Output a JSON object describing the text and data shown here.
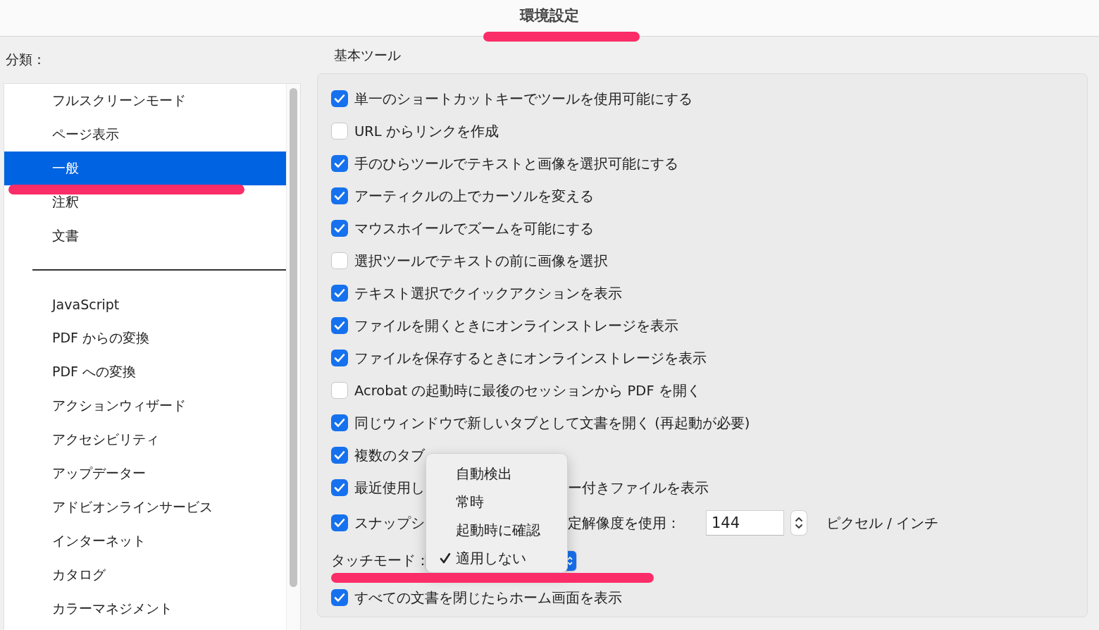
{
  "window": {
    "title": "環境設定",
    "highlighted": true
  },
  "sidebar": {
    "label": "分類：",
    "items": [
      {
        "label": "フルスクリーンモード",
        "selected": false,
        "highlighted": false
      },
      {
        "label": "ページ表示",
        "selected": false,
        "highlighted": false
      },
      {
        "label": "一般",
        "selected": true,
        "highlighted": true
      },
      {
        "label": "注釈",
        "selected": false,
        "highlighted": false
      },
      {
        "label": "文書",
        "selected": false,
        "highlighted": false
      },
      {
        "kind": "divider"
      },
      {
        "label": "JavaScript",
        "selected": false,
        "highlighted": false
      },
      {
        "label": "PDF からの変換",
        "selected": false,
        "highlighted": false
      },
      {
        "label": "PDF への変換",
        "selected": false,
        "highlighted": false
      },
      {
        "label": "アクションウィザード",
        "selected": false,
        "highlighted": false
      },
      {
        "label": "アクセシビリティ",
        "selected": false,
        "highlighted": false
      },
      {
        "label": "アップデーター",
        "selected": false,
        "highlighted": false
      },
      {
        "label": "アドビオンラインサービス",
        "selected": false,
        "highlighted": false
      },
      {
        "label": "インターネット",
        "selected": false,
        "highlighted": false
      },
      {
        "label": "カタログ",
        "selected": false,
        "highlighted": false
      },
      {
        "label": "カラーマネジメント",
        "selected": false,
        "highlighted": false
      }
    ]
  },
  "section": {
    "title": "基本ツール",
    "rows": [
      {
        "kind": "checkbox",
        "label": "単一のショートカットキーでツールを使用可能にする",
        "checked": true
      },
      {
        "kind": "checkbox",
        "label": "URL からリンクを作成",
        "checked": false
      },
      {
        "kind": "checkbox",
        "label": "手のひらツールでテキストと画像を選択可能にする",
        "checked": true
      },
      {
        "kind": "checkbox",
        "label": "アーティクルの上でカーソルを変える",
        "checked": true
      },
      {
        "kind": "checkbox",
        "label": "マウスホイールでズームを可能にする",
        "checked": true
      },
      {
        "kind": "checkbox",
        "label": "選択ツールでテキストの前に画像を選択",
        "checked": false
      },
      {
        "kind": "checkbox",
        "label": "テキスト選択でクイックアクションを表示",
        "checked": true
      },
      {
        "kind": "checkbox",
        "label": "ファイルを開くときにオンラインストレージを表示",
        "checked": true
      },
      {
        "kind": "checkbox",
        "label": "ファイルを保存するときにオンラインストレージを表示",
        "checked": true
      },
      {
        "kind": "checkbox",
        "label": "Acrobat の起動時に最後のセッションから PDF を開く",
        "checked": false
      },
      {
        "kind": "checkbox",
        "label": "同じウィンドウで新しいタブとして文書を開く (再起動が必要)",
        "checked": true
      },
      {
        "kind": "checkbox",
        "label": "複数のタブ",
        "checked": true
      },
      {
        "kind": "split",
        "label": "最近使用し",
        "tail": "ー付きファイルを表示",
        "checked": true
      },
      {
        "kind": "resolution",
        "label": "スナップシ",
        "tail": "定解像度を使用：",
        "checked": true,
        "value": "144",
        "unit": "ピクセル / インチ"
      },
      {
        "kind": "select",
        "label": "タッチモード：",
        "highlighted": true
      },
      {
        "kind": "checkbox",
        "label": "すべての文書を閉じたらホーム画面を表示",
        "checked": true
      }
    ]
  },
  "popup": {
    "items": [
      {
        "label": "自動検出",
        "selected": false
      },
      {
        "label": "常時",
        "selected": false
      },
      {
        "label": "起動時に確認",
        "selected": false
      },
      {
        "label": "適用しない",
        "selected": true
      }
    ]
  }
}
